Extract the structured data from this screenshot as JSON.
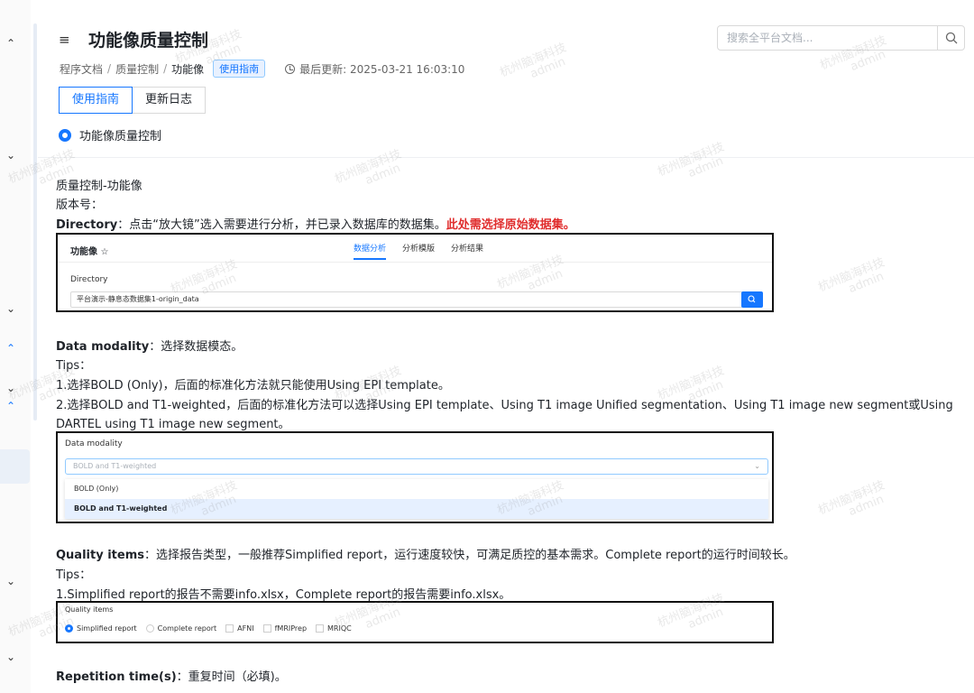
{
  "header": {
    "menu_icon": "menu-fold-icon",
    "title": "功能像质量控制",
    "search_placeholder": "搜索全平台文档...",
    "search_icon": "search-icon"
  },
  "breadcrumb": {
    "items": [
      "程序文档",
      "质量控制",
      "功能像"
    ],
    "badge": "使用指南",
    "updated": "最后更新: 2025-03-21 16:03:10"
  },
  "tabs": [
    {
      "label": "使用指南",
      "active": true
    },
    {
      "label": "更新日志",
      "active": false
    }
  ],
  "section_radio": "功能像质量控制",
  "content": {
    "line1": "质量控制-功能像",
    "line2": "版本号：",
    "directory_label": "Directory",
    "directory_text": "：点击“放大镜”选入需要进行分析，并已录入数据库的数据集。",
    "directory_red": "此处需选择原始数据集。",
    "modality_label": "Data modality",
    "modality_text": "：选择数据模态。",
    "tips1": "Tips：",
    "tip1_1": "1.选择BOLD (Only)，后面的标准化方法就只能使用Using EPI template。",
    "tip1_2a": "2.选择BOLD and T1-weighted，后面的标准化方法可以选择Using EPI template、Using T1 image Unified segmentation、Using T1 image new segment或Using",
    "tip1_2b": "DARTEL using T1 image new segment。",
    "quality_label": "Quality items",
    "quality_text": "：选择报告类型，一般推荐Simplified report，运行速度较快，可满足质控的基本需求。Complete report的运行时间较长。",
    "tips2": "Tips：",
    "tip2_1": "1.Simplified report的报告不需要info.xlsx，Complete report的报告需要info.xlsx。",
    "rep_label": "Repetition time(s)",
    "rep_text": "：重复时间（必填)。"
  },
  "shot1": {
    "title": "功能像",
    "tabs": [
      "数据分析",
      "分析模版",
      "分析结果"
    ],
    "field_label": "Directory",
    "field_value": "平台演示-静息态数据集1-origin_data"
  },
  "shot2": {
    "label": "Data modality",
    "selected": "BOLD and T1-weighted",
    "options": [
      "BOLD (Only)",
      "BOLD and T1-weighted"
    ]
  },
  "shot3": {
    "label": "Quality items",
    "radios": [
      "Simplified report",
      "Complete report"
    ],
    "checks": [
      "AFNI",
      "fMRIPrep",
      "MRIQC"
    ]
  },
  "watermark": {
    "line1": "杭州脑海科技",
    "line2": "admin"
  },
  "colors": {
    "accent": "#1677ff",
    "warning_red": "#e02d2d"
  }
}
